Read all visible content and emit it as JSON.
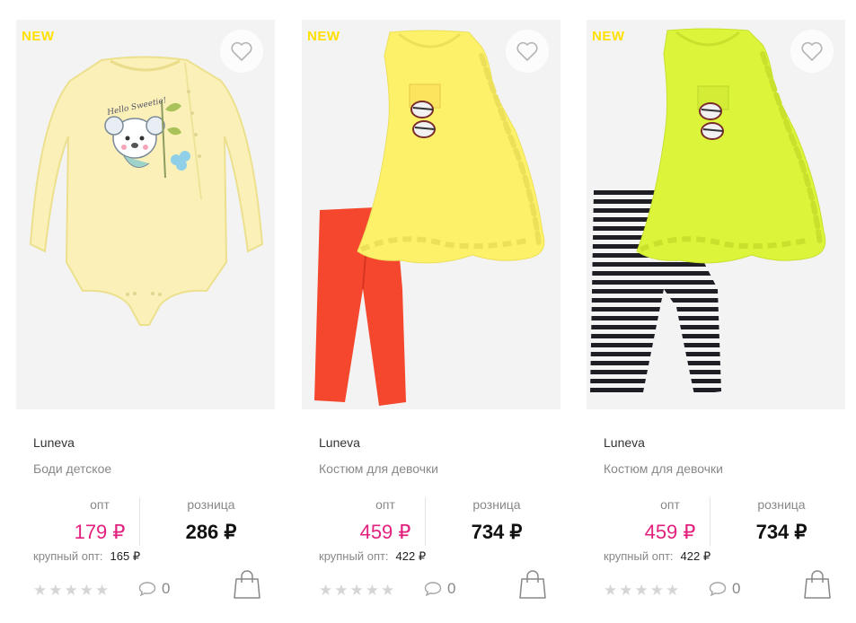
{
  "colors": {
    "badge": "#ffe000",
    "opt_price": "#e2207d",
    "retail_price": "#111111",
    "muted": "#888888",
    "star_inactive": "#d5d5d5"
  },
  "products": [
    {
      "badge": "NEW",
      "brand": "Luneva",
      "name": "Боди детское",
      "opt_label": "опт",
      "opt_price": "179 ₽",
      "retail_label": "розница",
      "retail_price": "286 ₽",
      "bulk_label": "крупный опт:",
      "bulk_price": "165 ₽",
      "rating": 0,
      "comments": "0",
      "image_text": "Hello Sweetie!",
      "icons": {
        "favorite": "heart-outline-icon",
        "comments": "speech-bubble-icon",
        "cart": "shopping-bag-icon"
      }
    },
    {
      "badge": "NEW",
      "brand": "Luneva",
      "name": "Костюм для девочки",
      "opt_label": "опт",
      "opt_price": "459 ₽",
      "retail_label": "розница",
      "retail_price": "734 ₽",
      "bulk_label": "крупный опт:",
      "bulk_price": "422 ₽",
      "rating": 0,
      "comments": "0",
      "icons": {
        "favorite": "heart-outline-icon",
        "comments": "speech-bubble-icon",
        "cart": "shopping-bag-icon"
      }
    },
    {
      "badge": "NEW",
      "brand": "Luneva",
      "name": "Костюм для девочки",
      "opt_label": "опт",
      "opt_price": "459 ₽",
      "retail_label": "розница",
      "retail_price": "734 ₽",
      "bulk_label": "крупный опт:",
      "bulk_price": "422 ₽",
      "rating": 0,
      "comments": "0",
      "icons": {
        "favorite": "heart-outline-icon",
        "comments": "speech-bubble-icon",
        "cart": "shopping-bag-icon"
      }
    }
  ]
}
